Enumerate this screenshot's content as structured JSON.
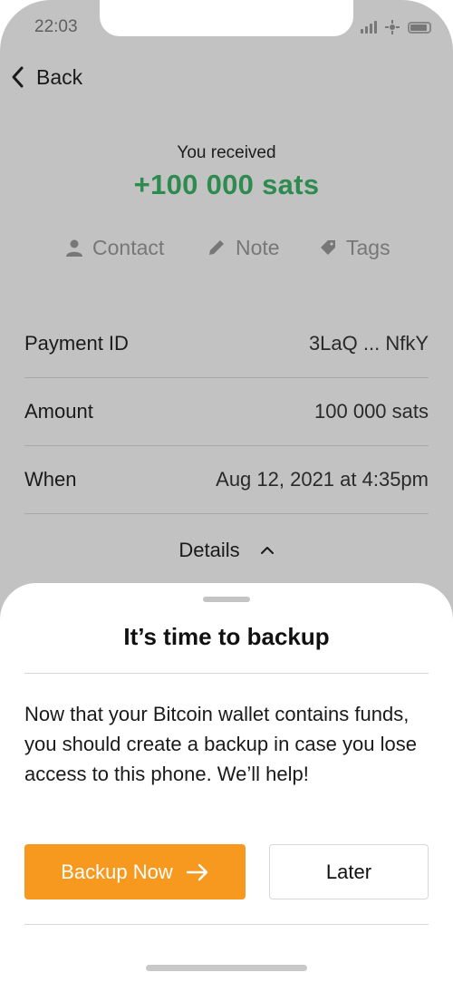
{
  "status_bar": {
    "time": "22:03"
  },
  "nav": {
    "back_label": "Back"
  },
  "payment": {
    "received_label": "You received",
    "amount": "+100 000 sats",
    "amount_color": "#2e8b4f"
  },
  "actions": {
    "contact": "Contact",
    "note": "Note",
    "tags": "Tags"
  },
  "details": {
    "rows": [
      {
        "label": "Payment ID",
        "value": "3LaQ ... NfkY"
      },
      {
        "label": "Amount",
        "value": "100 000 sats"
      },
      {
        "label": "When",
        "value": "Aug 12, 2021 at 4:35pm"
      }
    ],
    "toggle_label": "Details"
  },
  "sheet": {
    "title": "It’s time to backup",
    "body": "Now that your Bitcoin wallet contains funds, you should create a backup in case you lose access to this phone. We’ll help!",
    "primary_button": "Backup Now",
    "secondary_button": "Later",
    "accent_color": "#f6991e"
  },
  "icons": {
    "back": "chevron-left-icon",
    "contact": "person-icon",
    "note": "pencil-icon",
    "tags": "tag-icon",
    "details": "chevron-up-icon",
    "backup": "arrow-right-icon"
  }
}
